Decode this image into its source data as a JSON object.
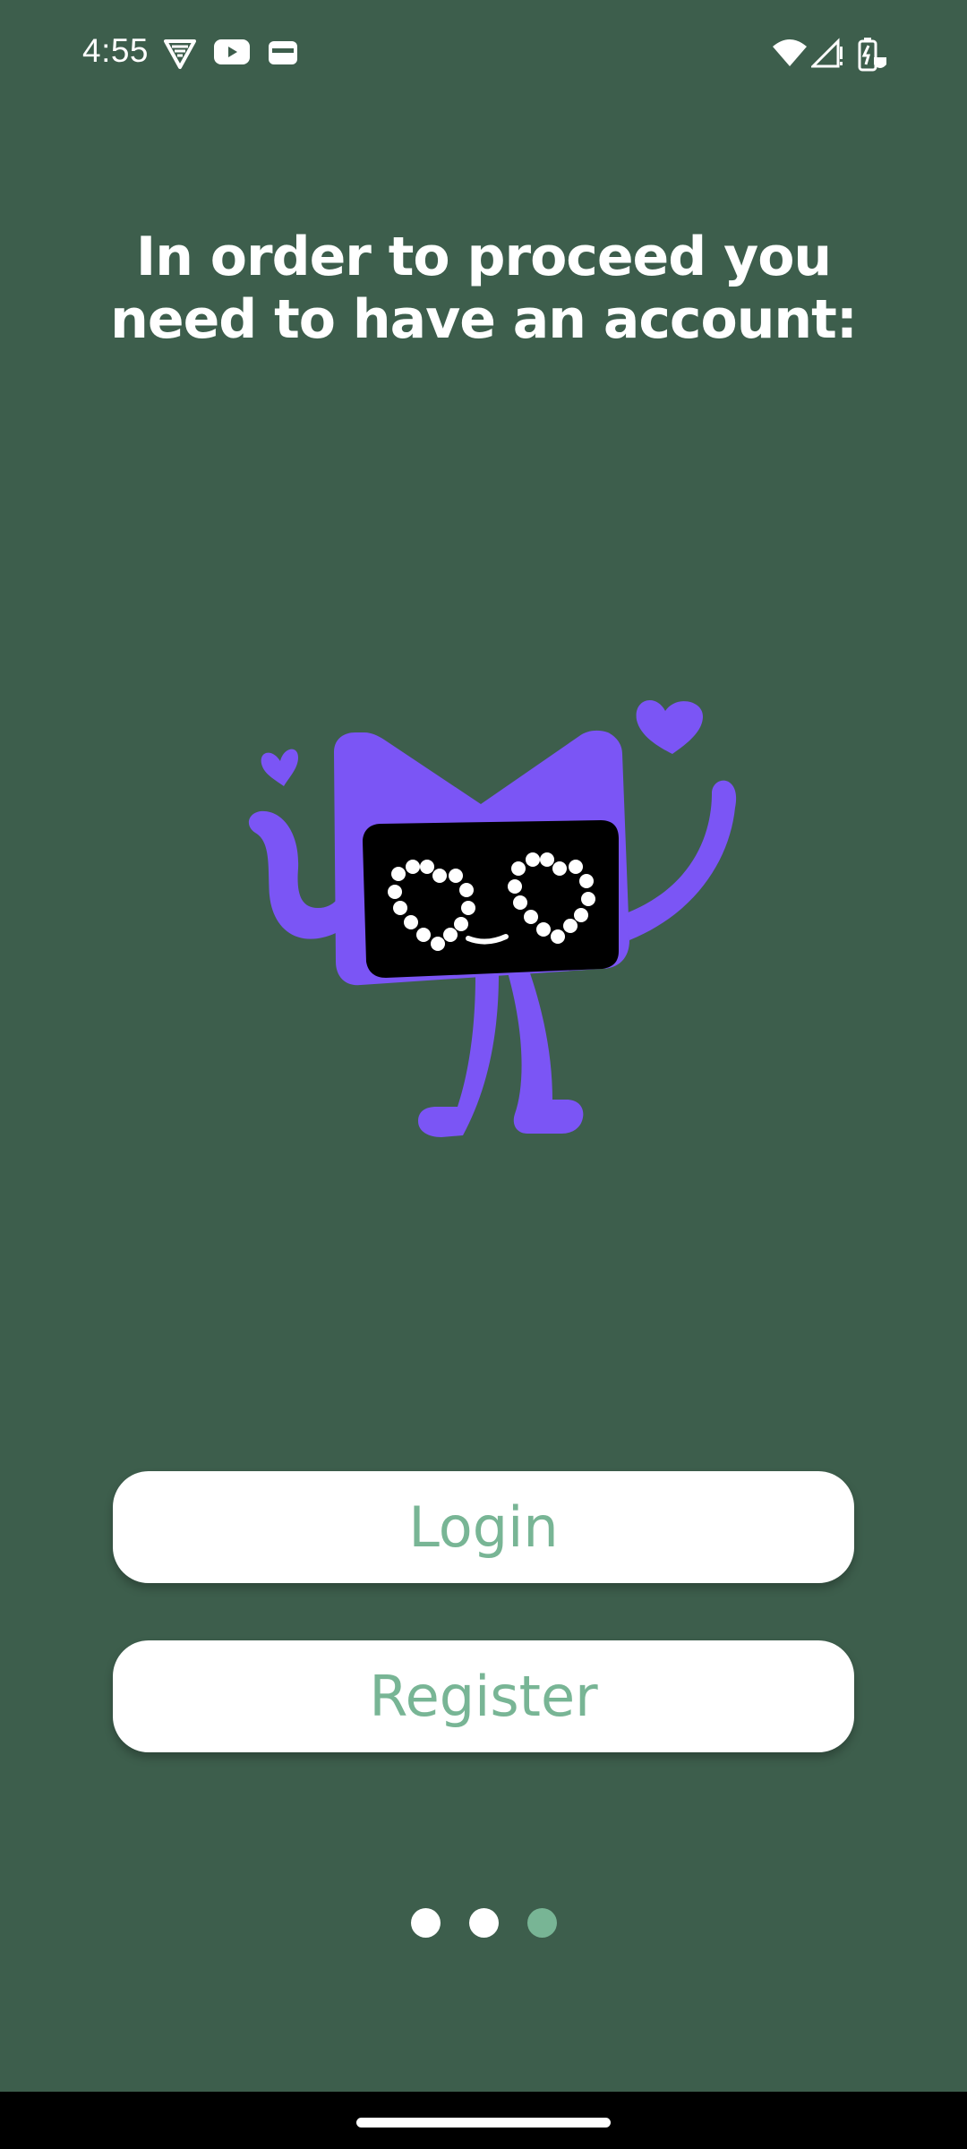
{
  "status_bar": {
    "time": "4:55",
    "left_icons": [
      "vpn-shield-icon",
      "youtube-icon",
      "wallet-icon"
    ],
    "right_icons": [
      "wifi-icon",
      "cell-signal-icon",
      "battery-charging-icon"
    ]
  },
  "onboarding": {
    "headline": "In order to proceed you need to have an account:",
    "illustration": "purple-robot-mascot-with-heart-eyes",
    "login_label": "Login",
    "register_label": "Register",
    "page_indicator": {
      "total": 3,
      "current": 3
    }
  },
  "colors": {
    "background": "#3d5e4c",
    "accent": "#78b595",
    "mascot": "#7b55f5",
    "button_bg": "#ffffff"
  }
}
